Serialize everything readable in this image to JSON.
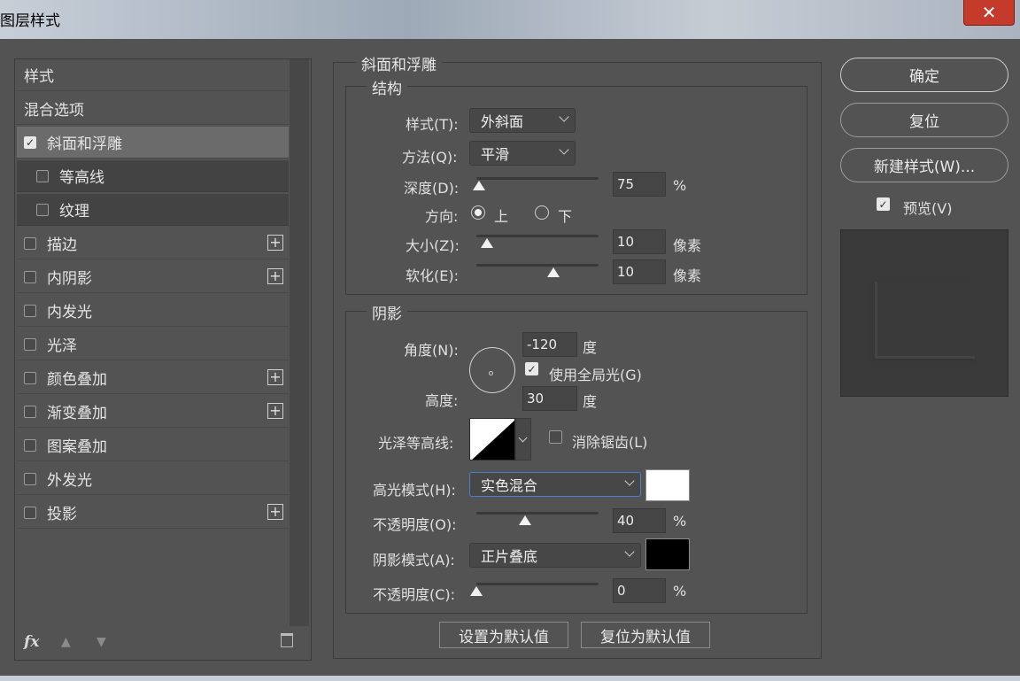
{
  "window": {
    "title": "图层样式",
    "close_glyph": "✕"
  },
  "sidebar": {
    "items": [
      {
        "label": "样式",
        "checkbox": false,
        "checked": false,
        "add": false,
        "sub": false,
        "selected": false
      },
      {
        "label": "混合选项",
        "checkbox": false,
        "checked": false,
        "add": false,
        "sub": false,
        "selected": false
      },
      {
        "label": "斜面和浮雕",
        "checkbox": true,
        "checked": true,
        "add": false,
        "sub": false,
        "selected": true
      },
      {
        "label": "等高线",
        "checkbox": true,
        "checked": false,
        "add": false,
        "sub": true,
        "selected": false
      },
      {
        "label": "纹理",
        "checkbox": true,
        "checked": false,
        "add": false,
        "sub": true,
        "selected": false
      },
      {
        "label": "描边",
        "checkbox": true,
        "checked": false,
        "add": true,
        "sub": false,
        "selected": false
      },
      {
        "label": "内阴影",
        "checkbox": true,
        "checked": false,
        "add": true,
        "sub": false,
        "selected": false
      },
      {
        "label": "内发光",
        "checkbox": true,
        "checked": false,
        "add": false,
        "sub": false,
        "selected": false
      },
      {
        "label": "光泽",
        "checkbox": true,
        "checked": false,
        "add": false,
        "sub": false,
        "selected": false
      },
      {
        "label": "颜色叠加",
        "checkbox": true,
        "checked": false,
        "add": true,
        "sub": false,
        "selected": false
      },
      {
        "label": "渐变叠加",
        "checkbox": true,
        "checked": false,
        "add": true,
        "sub": false,
        "selected": false
      },
      {
        "label": "图案叠加",
        "checkbox": true,
        "checked": false,
        "add": false,
        "sub": false,
        "selected": false
      },
      {
        "label": "外发光",
        "checkbox": true,
        "checked": false,
        "add": false,
        "sub": false,
        "selected": false
      },
      {
        "label": "投影",
        "checkbox": true,
        "checked": false,
        "add": true,
        "sub": false,
        "selected": false
      }
    ],
    "footer": {
      "fx": "fx",
      "up": "▲",
      "down": "▼"
    }
  },
  "bevel": {
    "title": "斜面和浮雕",
    "structure": {
      "title": "结构",
      "style_label": "样式(T):",
      "style_value": "外斜面",
      "technique_label": "方法(Q):",
      "technique_value": "平滑",
      "depth_label": "深度(D):",
      "depth_value": "75",
      "depth_unit": "%",
      "depth_pos": 0.02,
      "direction_label": "方向:",
      "direction_up": "上",
      "direction_down": "下",
      "direction_selected": "up",
      "size_label": "大小(Z):",
      "size_value": "10",
      "size_unit": "像素",
      "size_pos": 0.09,
      "soften_label": "软化(E):",
      "soften_value": "10",
      "soften_unit": "像素",
      "soften_pos": 0.63
    },
    "shading": {
      "title": "阴影",
      "angle_label": "角度(N):",
      "angle_value": "-120",
      "angle_unit": "度",
      "global_light_label": "使用全局光(G)",
      "global_light_checked": true,
      "altitude_label": "高度:",
      "altitude_value": "30",
      "altitude_unit": "度",
      "gloss_contour_label": "光泽等高线:",
      "anti_alias_label": "消除锯齿(L)",
      "anti_alias_checked": false,
      "highlight_mode_label": "高光模式(H):",
      "highlight_mode_value": "实色混合",
      "highlight_color": "#ffffff",
      "highlight_opacity_label": "不透明度(O):",
      "highlight_opacity_value": "40",
      "highlight_opacity_unit": "%",
      "highlight_opacity_pos": 0.4,
      "shadow_mode_label": "阴影模式(A):",
      "shadow_mode_value": "正片叠底",
      "shadow_color": "#000000",
      "shadow_opacity_label": "不透明度(C):",
      "shadow_opacity_value": "0",
      "shadow_opacity_unit": "%",
      "shadow_opacity_pos": 0.0
    },
    "set_default": "设置为默认值",
    "reset_default": "复位为默认值"
  },
  "actions": {
    "ok": "确定",
    "reset": "复位",
    "new_style": "新建样式(W)...",
    "preview_label": "预览(V)",
    "preview_checked": true
  }
}
